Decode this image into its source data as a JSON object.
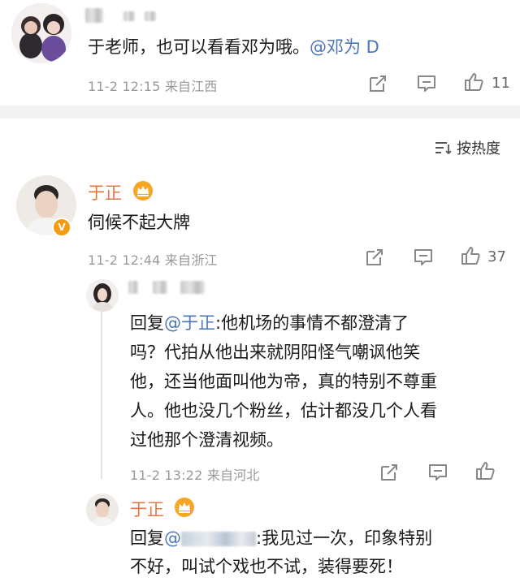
{
  "top_comment": {
    "text": "于老师，也可以看看邓为哦。",
    "mention": "@邓为 D",
    "timestamp": "11-2 12:15",
    "location": "来自江西",
    "like_count": "11"
  },
  "sort_control": {
    "label": "按热度"
  },
  "main_comment": {
    "author": "于正",
    "text": "伺候不起大牌",
    "timestamp": "11-2 12:44",
    "location": "来自浙江",
    "like_count": "37"
  },
  "reply_1": {
    "prefix": "回复",
    "mention": "@于正",
    "text_lines": [
      ":他机场的事情不都澄清了",
      "吗？代拍从他出来就阴阳怪气嘲讽他笑",
      "他，还当他面叫他为帝，真的特别不尊重",
      "人。他也没几个粉丝，估计都没几个人看",
      "过他那个澄清视频。"
    ],
    "timestamp": "11-2 13:22",
    "location": "来自河北"
  },
  "reply_2": {
    "author": "于正",
    "prefix": "回复",
    "mention": "@",
    "text_lines": [
      ":我见过一次，印象特别",
      "不好，叫试个戏也不试，装得要死！"
    ]
  },
  "colors": {
    "name": "#eb7340",
    "mention": "#4a76b8",
    "meta": "#999999",
    "crown": "#f5a623"
  }
}
